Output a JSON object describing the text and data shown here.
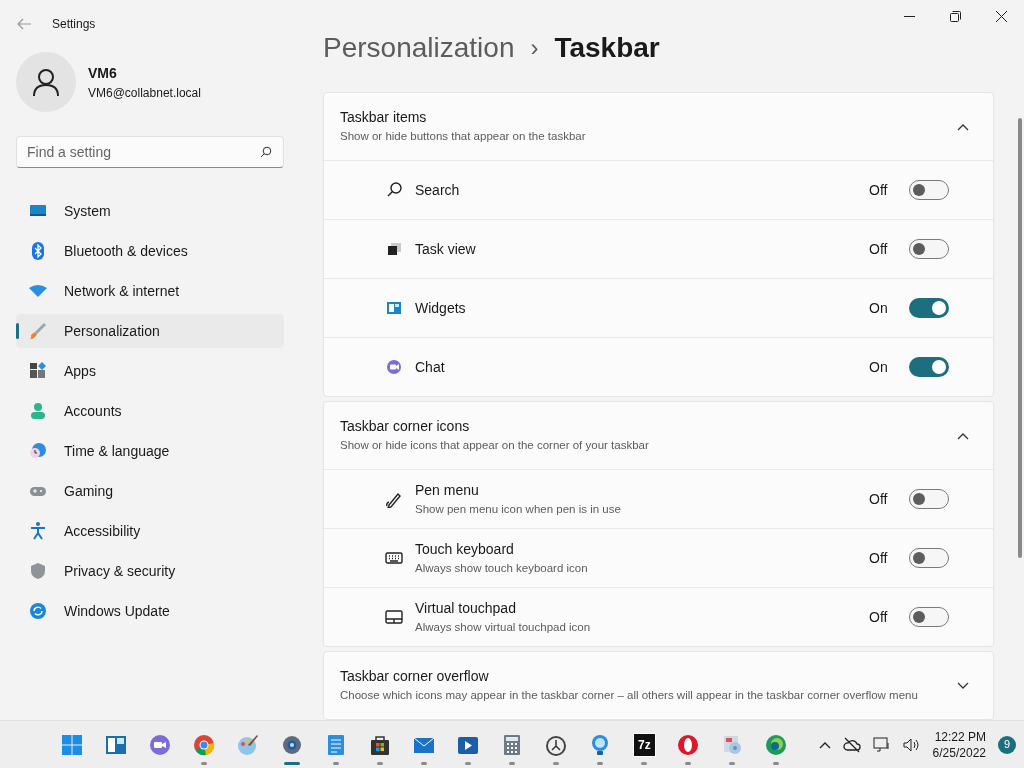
{
  "window": {
    "title": "Settings"
  },
  "user": {
    "name": "VM6",
    "email": "VM6@collabnet.local"
  },
  "search": {
    "placeholder": "Find a setting"
  },
  "nav": [
    {
      "kind": "system",
      "label": "System",
      "selected": false
    },
    {
      "kind": "bluetooth",
      "label": "Bluetooth & devices",
      "selected": false
    },
    {
      "kind": "network",
      "label": "Network & internet",
      "selected": false
    },
    {
      "kind": "personalization",
      "label": "Personalization",
      "selected": true
    },
    {
      "kind": "apps",
      "label": "Apps",
      "selected": false
    },
    {
      "kind": "accounts",
      "label": "Accounts",
      "selected": false
    },
    {
      "kind": "time",
      "label": "Time & language",
      "selected": false
    },
    {
      "kind": "gaming",
      "label": "Gaming",
      "selected": false
    },
    {
      "kind": "accessibility",
      "label": "Accessibility",
      "selected": false
    },
    {
      "kind": "privacy",
      "label": "Privacy & security",
      "selected": false
    },
    {
      "kind": "update",
      "label": "Windows Update",
      "selected": false
    }
  ],
  "breadcrumb": {
    "parent": "Personalization",
    "separator": "›",
    "current": "Taskbar"
  },
  "sections": [
    {
      "title": "Taskbar items",
      "subtitle": "Show or hide buttons that appear on the taskbar",
      "expanded": true,
      "items": [
        {
          "kind": "search",
          "label": "Search",
          "state": "Off",
          "on": false
        },
        {
          "kind": "taskview",
          "label": "Task view",
          "state": "Off",
          "on": false
        },
        {
          "kind": "widgets",
          "label": "Widgets",
          "state": "On",
          "on": true
        },
        {
          "kind": "chat",
          "label": "Chat",
          "state": "On",
          "on": true
        }
      ]
    },
    {
      "title": "Taskbar corner icons",
      "subtitle": "Show or hide icons that appear on the corner of your taskbar",
      "expanded": true,
      "items": [
        {
          "kind": "pen",
          "label": "Pen menu",
          "description": "Show pen menu icon when pen is in use",
          "state": "Off",
          "on": false
        },
        {
          "kind": "keyboard",
          "label": "Touch keyboard",
          "description": "Always show touch keyboard icon",
          "state": "Off",
          "on": false
        },
        {
          "kind": "touchpad",
          "label": "Virtual touchpad",
          "description": "Always show virtual touchpad icon",
          "state": "Off",
          "on": false
        }
      ]
    },
    {
      "title": "Taskbar corner overflow",
      "subtitle": "Choose which icons may appear in the taskbar corner – all others will appear in the taskbar corner overflow menu",
      "expanded": false
    }
  ],
  "taskbar": {
    "apps": [
      {
        "kind": "start",
        "running": false,
        "selected": false
      },
      {
        "kind": "widgets",
        "running": false,
        "selected": false
      },
      {
        "kind": "chat",
        "running": false,
        "selected": false
      },
      {
        "kind": "chrome",
        "running": true,
        "selected": false
      },
      {
        "kind": "paint",
        "running": false,
        "selected": false
      },
      {
        "kind": "settings",
        "running": true,
        "selected": true
      },
      {
        "kind": "notepad",
        "running": true,
        "selected": false
      },
      {
        "kind": "store",
        "running": true,
        "selected": false
      },
      {
        "kind": "mail",
        "running": true,
        "selected": false
      },
      {
        "kind": "video",
        "running": true,
        "selected": false
      },
      {
        "kind": "calculator",
        "running": true,
        "selected": false
      },
      {
        "kind": "clock",
        "running": true,
        "selected": false
      },
      {
        "kind": "tips",
        "running": true,
        "selected": false
      },
      {
        "kind": "archiver",
        "label": "7z",
        "running": true,
        "selected": false
      },
      {
        "kind": "opera",
        "running": true,
        "selected": false
      },
      {
        "kind": "media",
        "running": true,
        "selected": false
      },
      {
        "kind": "edge",
        "running": true,
        "selected": false
      }
    ],
    "time": "12:22 PM",
    "date": "6/25/2022",
    "badge": "9"
  }
}
